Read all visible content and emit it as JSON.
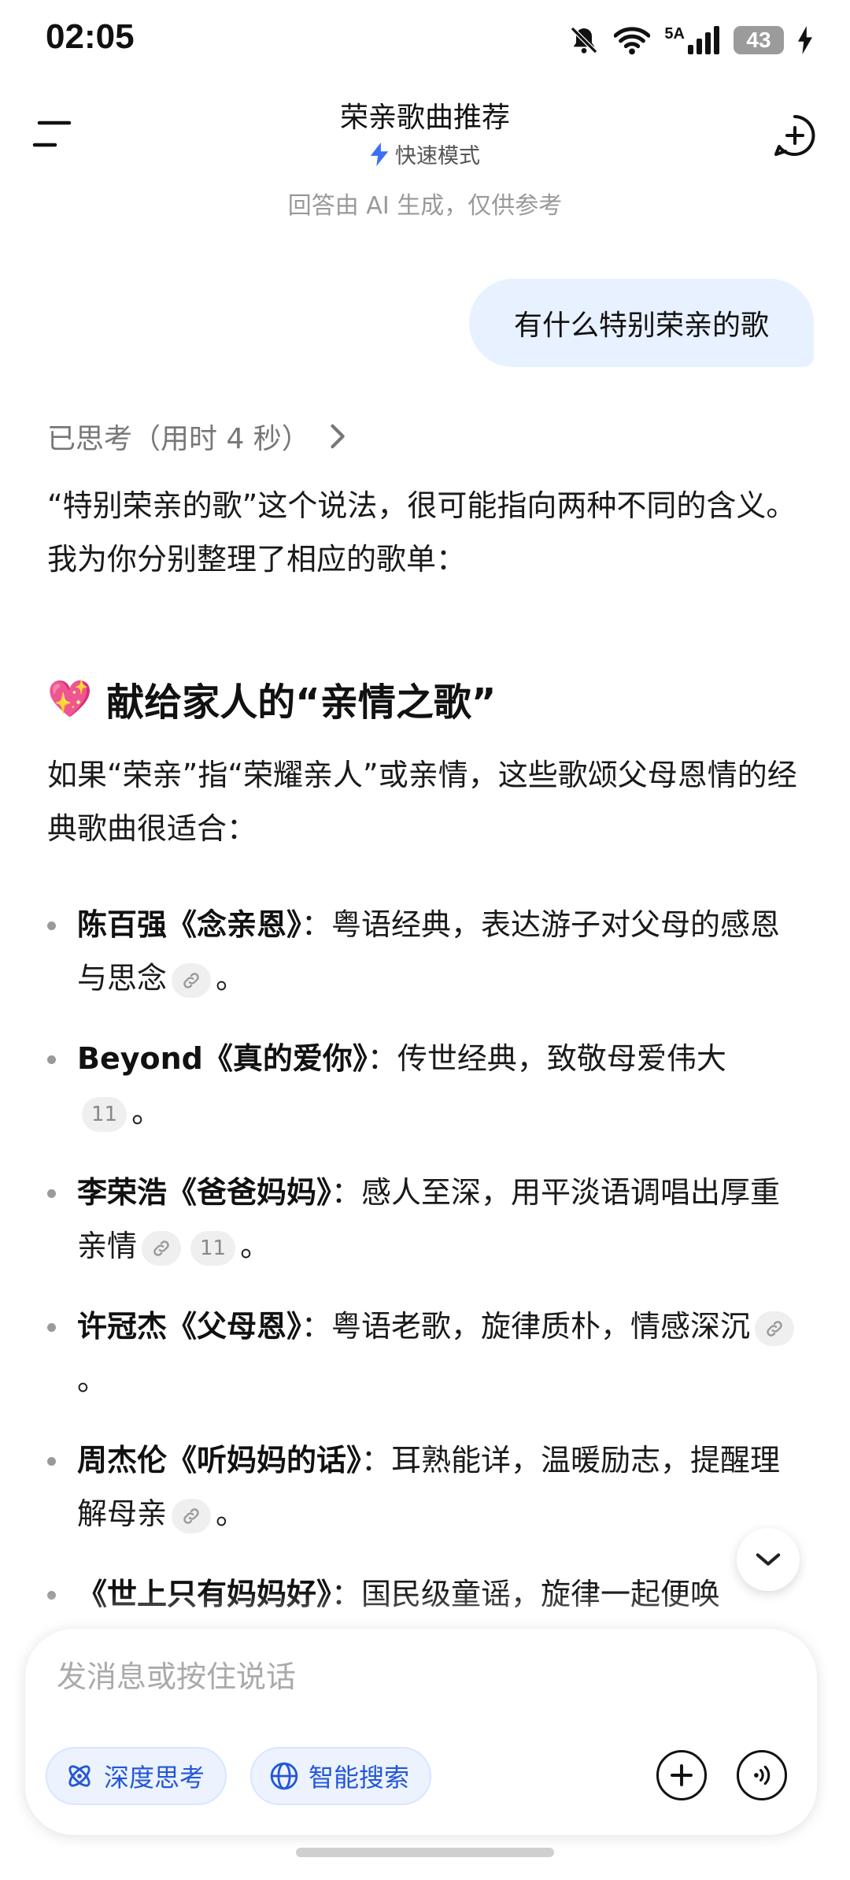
{
  "status_bar": {
    "time": "02:05",
    "network_label": "5A",
    "battery": "43",
    "icons": [
      "bell-muted-icon",
      "wifi-icon",
      "signal-icon",
      "battery-icon",
      "charging-icon"
    ]
  },
  "header": {
    "title": "荣亲歌曲推荐",
    "mode_label": "快速模式",
    "disclaimer": "回答由 AI 生成，仅供参考",
    "icons": [
      "menu-icon",
      "lightning-icon",
      "new-chat-icon"
    ]
  },
  "conversation": {
    "user_message": "有什么特别荣亲的歌",
    "thought_label": "已思考（用时 4 秒）",
    "intro": "“特别荣亲的歌”这个说法，很可能指向两种不同的含义。我为你分别整理了相应的歌单：",
    "section_emoji": "💖",
    "section_title": "献给家人的“亲情之歌”",
    "section_intro": "如果“荣亲”指“荣耀亲人”或亲情，这些歌颂父母恩情的经典歌曲很适合：",
    "songs": [
      {
        "title": "陈百强《念亲恩》",
        "sep": "：",
        "desc": "粤语经典，表达游子对父母的感恩与思念",
        "end": "。"
      },
      {
        "title": "Beyond《真的爱你》",
        "sep": "：",
        "desc": "传世经典，致敬母爱伟大",
        "badge": "11",
        "end": "。"
      },
      {
        "title": "李荣浩《爸爸妈妈》",
        "sep": "：",
        "desc": "感人至深，用平淡语调唱出厚重亲情",
        "badge": "11",
        "end": "。"
      },
      {
        "title": "许冠杰《父母恩》",
        "sep": "：",
        "desc": "粤语老歌，旋律质朴，情感深沉",
        "end": "。"
      },
      {
        "title": "周杰伦《听妈妈的话》",
        "sep": "：",
        "desc": "耳熟能详，温暖励志，提醒理解母亲",
        "end": "。"
      },
      {
        "title": "《世上只有妈妈好》",
        "sep": "：",
        "desc": "国民级童谣，旋律一起便唤"
      }
    ]
  },
  "composer": {
    "placeholder": "发消息或按住说话",
    "deep_think_label": "深度思考",
    "smart_search_label": "智能搜索",
    "icons": [
      "atom-icon",
      "globe-icon",
      "plus-icon",
      "voice-call-icon",
      "chevron-down-icon",
      "link-icon"
    ]
  },
  "colors": {
    "accent": "#2456d8",
    "user_bubble": "#e8f1ff",
    "chip_bg": "#efefef"
  }
}
